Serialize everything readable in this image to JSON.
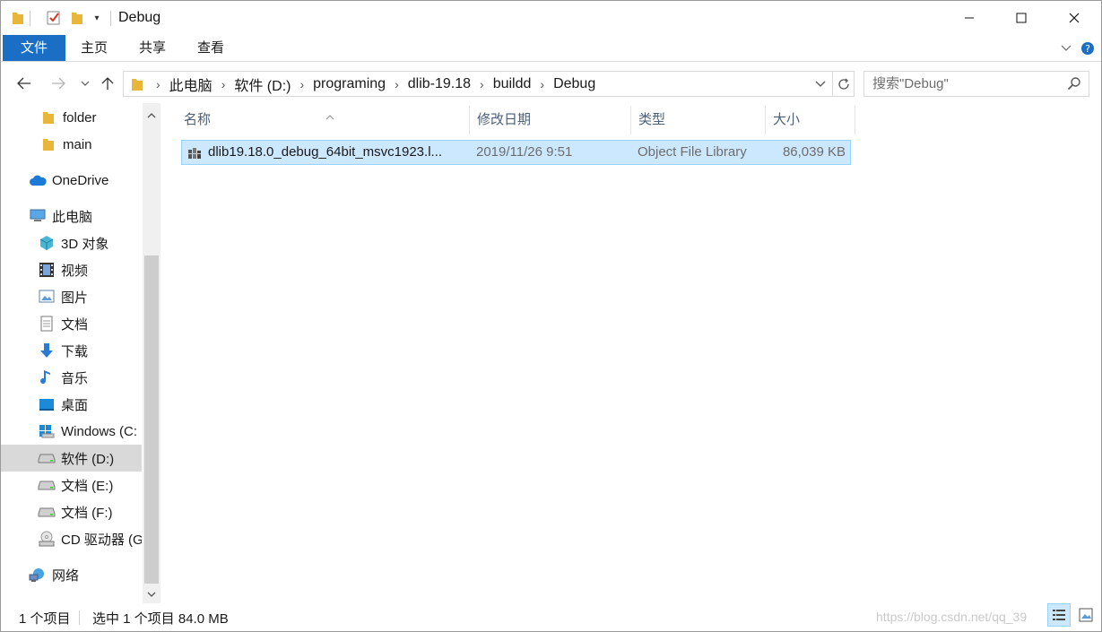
{
  "window": {
    "title": "Debug"
  },
  "ribbon": {
    "tabs": [
      {
        "label": "文件"
      },
      {
        "label": "主页"
      },
      {
        "label": "共享"
      },
      {
        "label": "查看"
      }
    ]
  },
  "address": {
    "crumbs": [
      {
        "label": "此电脑"
      },
      {
        "label": "软件 (D:)"
      },
      {
        "label": "programing"
      },
      {
        "label": "dlib-19.18"
      },
      {
        "label": "buildd"
      },
      {
        "label": "Debug"
      }
    ]
  },
  "search": {
    "placeholder": "搜索\"Debug\""
  },
  "navpane": {
    "items": [
      {
        "label": "folder",
        "icon": "folder-icon"
      },
      {
        "label": "main",
        "icon": "folder-icon"
      },
      {
        "label": "OneDrive",
        "icon": "cloud-icon"
      },
      {
        "label": "此电脑",
        "icon": "computer-icon"
      },
      {
        "label": "3D 对象",
        "icon": "cube-3d-icon"
      },
      {
        "label": "视频",
        "icon": "film-icon"
      },
      {
        "label": "图片",
        "icon": "picture-icon"
      },
      {
        "label": "文档",
        "icon": "document-icon"
      },
      {
        "label": "下载",
        "icon": "download-arrow-icon"
      },
      {
        "label": "音乐",
        "icon": "music-note-icon"
      },
      {
        "label": "桌面",
        "icon": "desktop-icon"
      },
      {
        "label": "Windows (C:",
        "icon": "windows-drive-icon"
      },
      {
        "label": "软件 (D:)",
        "icon": "drive-icon",
        "selected": true
      },
      {
        "label": "文档 (E:)",
        "icon": "drive-icon"
      },
      {
        "label": "文档 (F:)",
        "icon": "drive-icon"
      },
      {
        "label": "CD 驱动器 (G",
        "icon": "cd-drive-icon"
      },
      {
        "label": "网络",
        "icon": "network-icon"
      }
    ]
  },
  "filelist": {
    "columns": [
      {
        "label": "名称"
      },
      {
        "label": "修改日期"
      },
      {
        "label": "类型"
      },
      {
        "label": "大小"
      }
    ],
    "rows": [
      {
        "name": "dlib19.18.0_debug_64bit_msvc1923.l...",
        "modified": "2019/11/26 9:51",
        "type": "Object File Library",
        "size": "86,039 KB",
        "icon": "library-file-icon"
      }
    ]
  },
  "status": {
    "item_count": "1 个项目",
    "selection": "选中 1 个项目 84.0 MB",
    "watermark": "https://blog.csdn.net/qq_39"
  },
  "colors": {
    "accent": "#1a6fc4",
    "selection_bg": "#cce8ff",
    "selection_border": "#99d1ff",
    "folder": "#e8b73a"
  }
}
